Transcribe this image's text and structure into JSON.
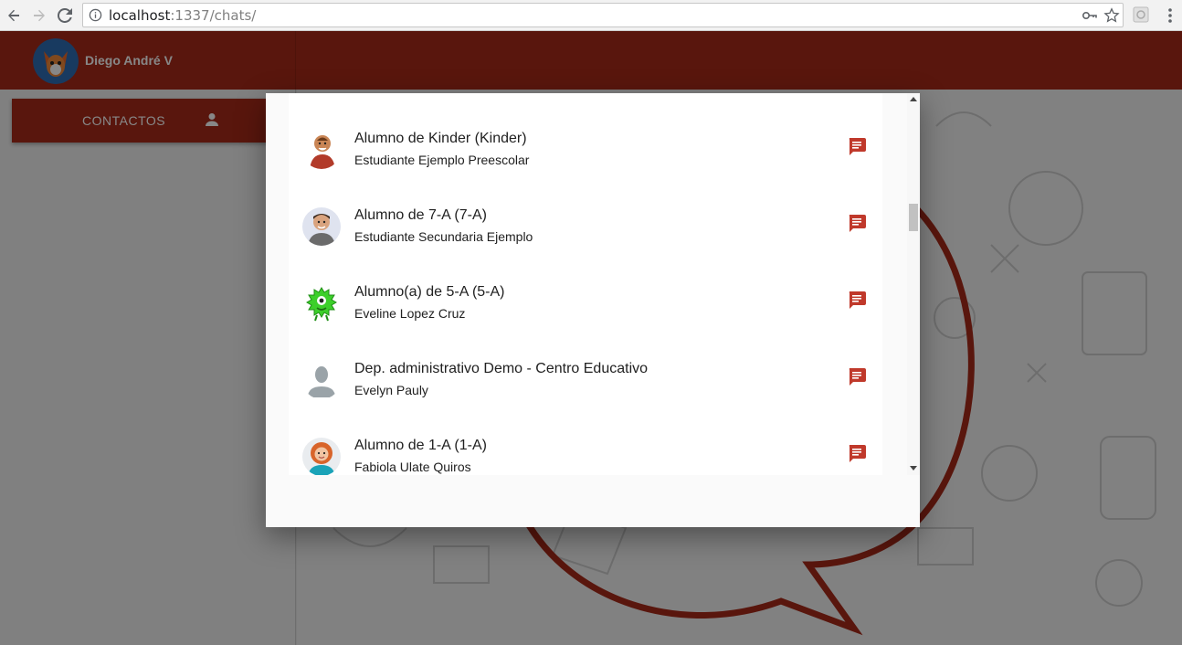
{
  "browser": {
    "url_host": "localhost",
    "url_rest": ":1337/chats/",
    "icons": [
      "back-arrow-icon",
      "forward-arrow-icon",
      "reload-icon",
      "info-icon",
      "key-icon",
      "star-icon",
      "extension-icon",
      "menu-icon"
    ]
  },
  "appbar": {
    "user_name": "Diego André V",
    "color": "#a82b1a"
  },
  "sidebar": {
    "contacts_label": "CONTACTOS"
  },
  "contacts": [
    {
      "title": "Alumno de Kinder (Kinder)",
      "subtitle": "Estudiante Ejemplo Preescolar",
      "avatar": "kid-photo"
    },
    {
      "title": "Alumno de 7-A (7-A)",
      "subtitle": "Estudiante Secundaria Ejemplo",
      "avatar": "teen-photo"
    },
    {
      "title": "Alumno(a) de 5-A (5-A)",
      "subtitle": "Eveline Lopez Cruz",
      "avatar": "green-monster"
    },
    {
      "title": "Dep. administrativo Demo - Centro Educativo",
      "subtitle": "Evelyn Pauly",
      "avatar": "default-person"
    },
    {
      "title": "Alumno de 1-A (1-A)",
      "subtitle": "Fabiola Ulate Quiros",
      "avatar": "girl-photo"
    }
  ],
  "accent_color": "#c0392b"
}
